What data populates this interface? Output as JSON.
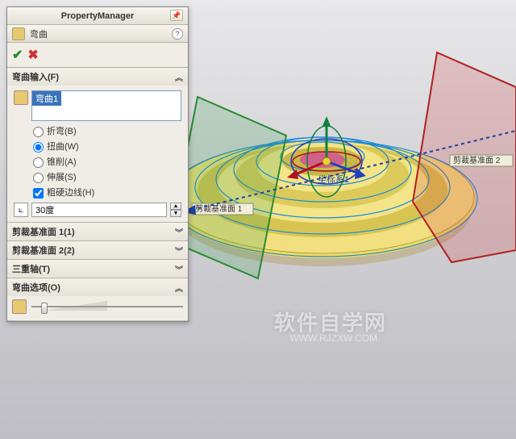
{
  "pm": {
    "title": "PropertyManager"
  },
  "feature": {
    "name": "弯曲"
  },
  "inputs": {
    "title": "弯曲输入(F)",
    "selection_label": "弯曲1",
    "radios": {
      "bend": "折弯(B)",
      "twist": "扭曲(W)",
      "taper": "锥削(A)",
      "stretch": "伸展(S)"
    },
    "selected_radio": "twist",
    "hard_edges_label": "粗硬边线(H)",
    "hard_edges_checked": true,
    "angle_value": "30度"
  },
  "sections": {
    "trim1": "剪裁基准面 1(1)",
    "trim2": "剪裁基准面 2(2)",
    "triad": "三重轴(T)",
    "options": "弯曲选项(O)"
  },
  "scene": {
    "triad_origin_label": "坐标系1",
    "plane1_label": "剪裁基准面 1",
    "plane2_label": "剪裁基准面 2"
  },
  "watermark": {
    "text": "软件自学网",
    "url": "WWW.RJZXW.COM"
  }
}
